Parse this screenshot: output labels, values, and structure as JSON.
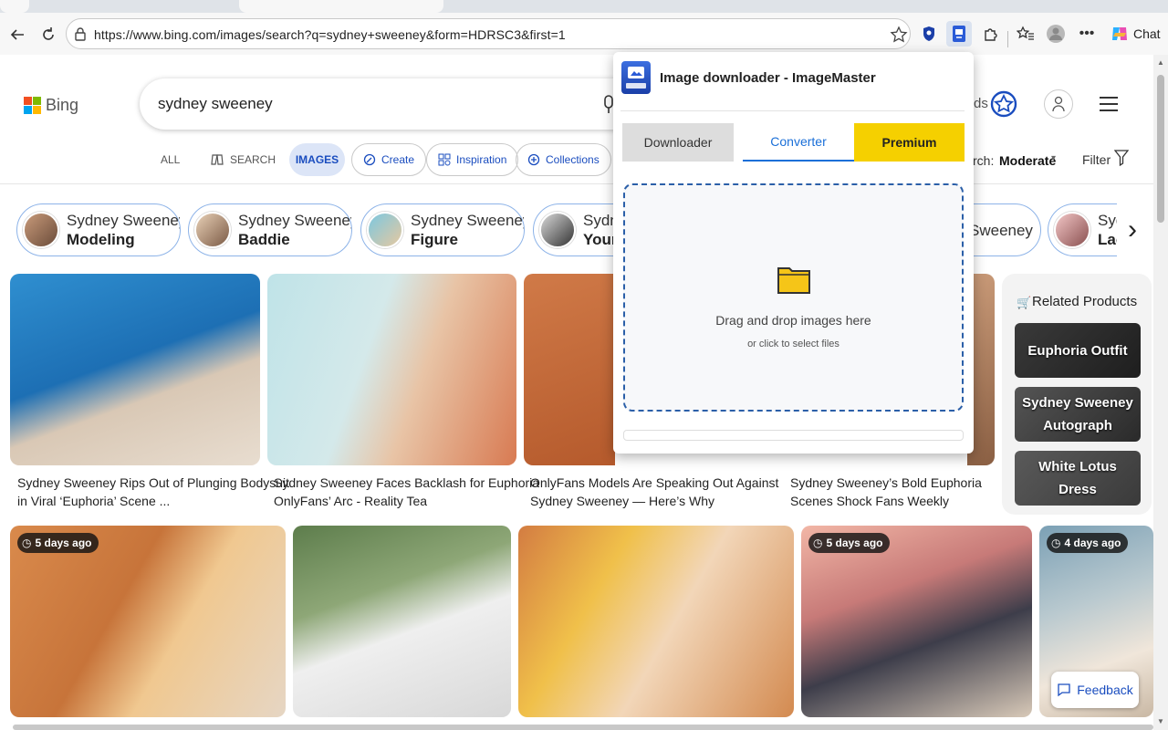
{
  "browser": {
    "url": "https://www.bing.com/images/search?q=sydney+sweeney&form=HDRSC3&first=1",
    "chat_label": "Chat"
  },
  "bing": {
    "logo_text": "Bing",
    "search_query": "sydney sweeney",
    "tabs": {
      "all": "ALL",
      "search": "SEARCH",
      "images": "IMAGES",
      "create": "Create",
      "inspiration": "Inspiration",
      "collections": "Collections"
    },
    "partial_rewards_text": "ds",
    "safesearch_label": "rch:",
    "safesearch_value": "Moderate",
    "filter_label": "Filter",
    "chips": [
      {
        "line1": "Sydney Sweeney",
        "line2": "Modeling"
      },
      {
        "line1": "Sydney Sweeney",
        "line2": "Baddie"
      },
      {
        "line1": "Sydney Sweeney",
        "line2": "Figure"
      },
      {
        "line1": "Sydne",
        "line2": "Young"
      },
      {
        "line1": "Sweeney",
        "line2": ""
      },
      {
        "line1": "Syd",
        "line2": "Lac"
      }
    ],
    "captions": [
      {
        "line1": "Sydney Sweeney Rips Out of Plunging Bodysuit",
        "line2": "in Viral ‘Euphoria’ Scene ..."
      },
      {
        "line1": "Sydney Sweeney Faces Backlash for Euphoria",
        "line2": "OnlyFans’ Arc - Reality Tea"
      },
      {
        "line1": "OnlyFans Models Are Speaking Out Against",
        "line2": "Sydney Sweeney — Here’s Why"
      },
      {
        "line1": "Sydney Sweeney’s Bold Euphoria",
        "line2": "Scenes Shock Fans Weekly"
      }
    ],
    "badges": [
      "5 days ago",
      "5 days ago",
      "4 days ago"
    ],
    "related": {
      "title": "Related Products",
      "items": [
        "Euphoria Outfit",
        "Sydney Sweeney Autograph",
        "White Lotus Dress"
      ]
    },
    "feedback_label": "Feedback"
  },
  "popup": {
    "title": "Image downloader - ImageMaster",
    "tabs": {
      "downloader": "Downloader",
      "converter": "Converter",
      "premium": "Premium"
    },
    "dropzone_title": "Drag and drop images here",
    "dropzone_subtitle": "or click to select files"
  },
  "colors": {
    "accent_blue": "#1a4dbf",
    "premium_yellow": "#f5d000",
    "dropzone_border": "#2b5fa8"
  }
}
